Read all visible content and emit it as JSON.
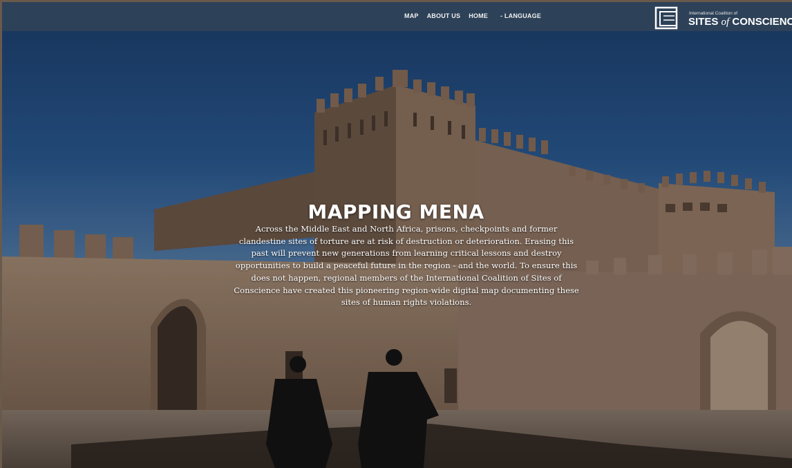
{
  "nav": {
    "items": [
      "MAP",
      "ABOUT US",
      "HOME"
    ],
    "language_label": "- LANGUAGE"
  },
  "logo": {
    "small_text": "International Coalition of",
    "big_text_1": "SITES",
    "big_text_of": "of",
    "big_text_2": "CONSCIENCE",
    "icon": "sites-of-conscience-logo-icon"
  },
  "hero": {
    "title": "MAPPING MENA",
    "description": "Across the Middle East and North Africa, prisons, checkpoints and former clandestine sites of torture are at risk of destruction or deterioration. Erasing this past will prevent new generations from learning critical lessons and destroy opportunities to build a peaceful future in the region - and the world. To ensure this does not happen, regional members of the International Coalition of Sites of Conscience have created this pioneering region-wide digital map documenting these sites of human rights violations."
  },
  "colors": {
    "nav_bar": "#304258",
    "sky": "#1f4a7e",
    "wall": "#a58a73",
    "text": "#ffffff"
  }
}
